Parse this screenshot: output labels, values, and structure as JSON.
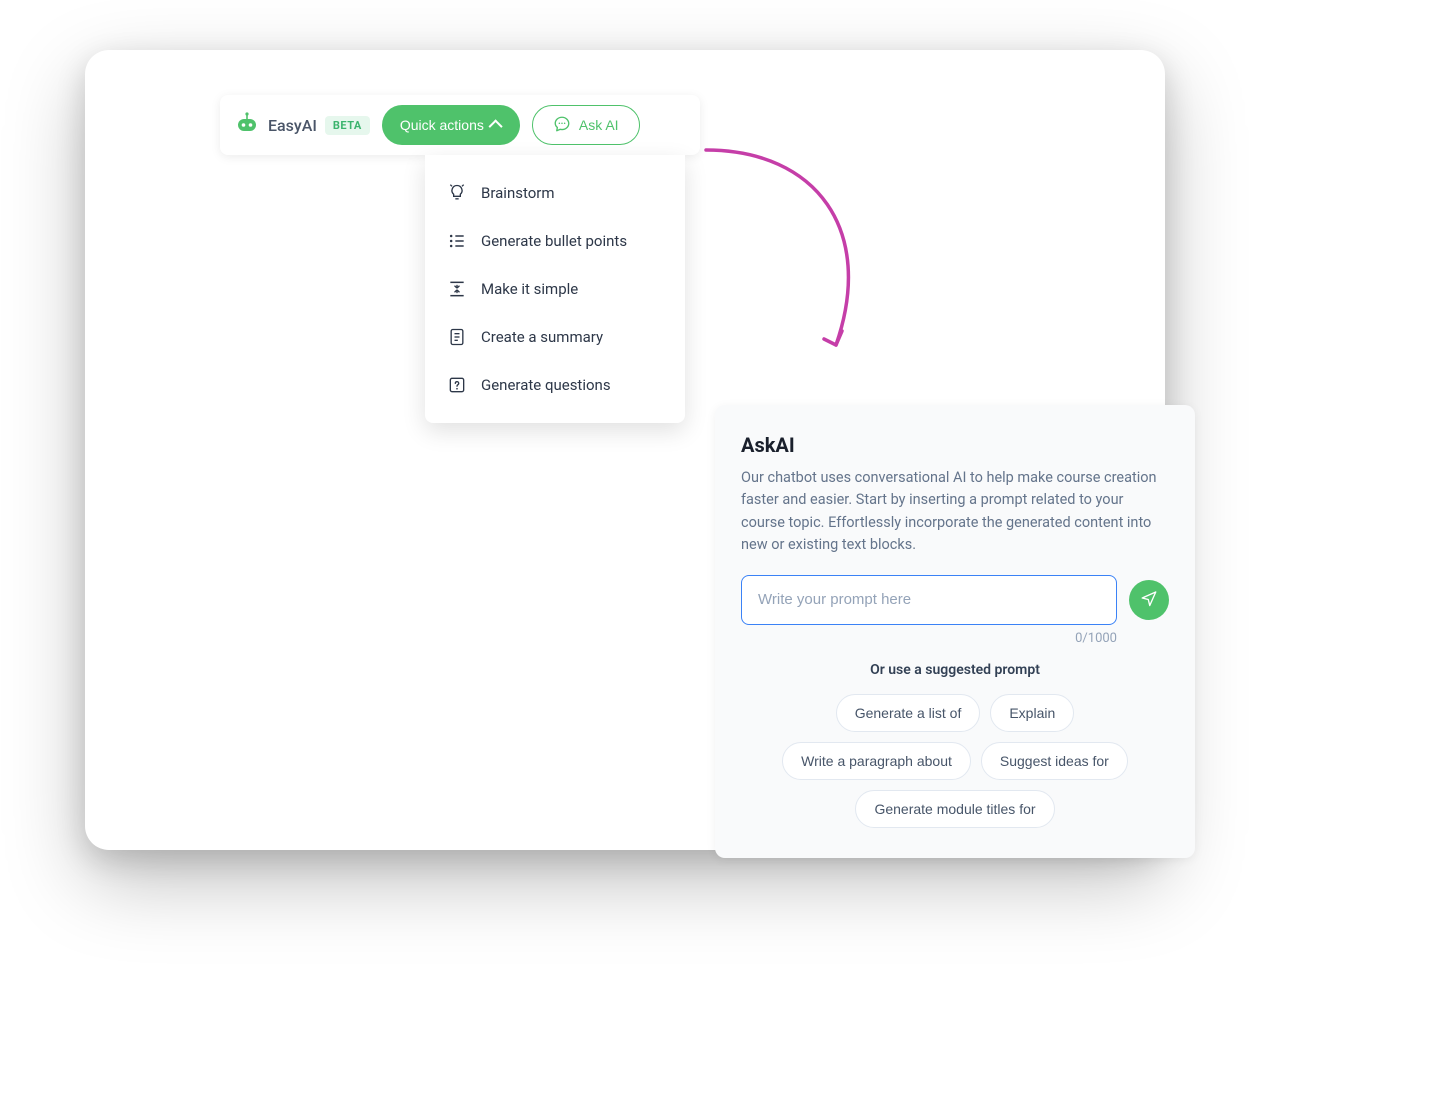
{
  "toolbar": {
    "brand_name": "EasyAI",
    "beta_label": "BETA",
    "quick_actions_label": "Quick actions",
    "ask_ai_label": "Ask AI"
  },
  "dropdown": {
    "items": [
      {
        "label": "Brainstorm",
        "icon": "lightbulb-icon"
      },
      {
        "label": "Generate bullet points",
        "icon": "bullet-list-icon"
      },
      {
        "label": "Make it simple",
        "icon": "collapse-icon"
      },
      {
        "label": "Create a summary",
        "icon": "document-icon"
      },
      {
        "label": "Generate questions",
        "icon": "question-icon"
      }
    ]
  },
  "askai": {
    "title": "AskAI",
    "description": "Our chatbot uses conversational AI to help make course creation faster and easier. Start by inserting a prompt related to your course topic. Effortlessly incorporate the generated content into new or existing text blocks.",
    "placeholder": "Write your prompt here",
    "char_count": "0/1000",
    "suggested_label": "Or use a suggested prompt",
    "chips": [
      "Generate a list of",
      "Explain",
      "Write a paragraph about",
      "Suggest ideas for",
      "Generate module titles for"
    ]
  }
}
